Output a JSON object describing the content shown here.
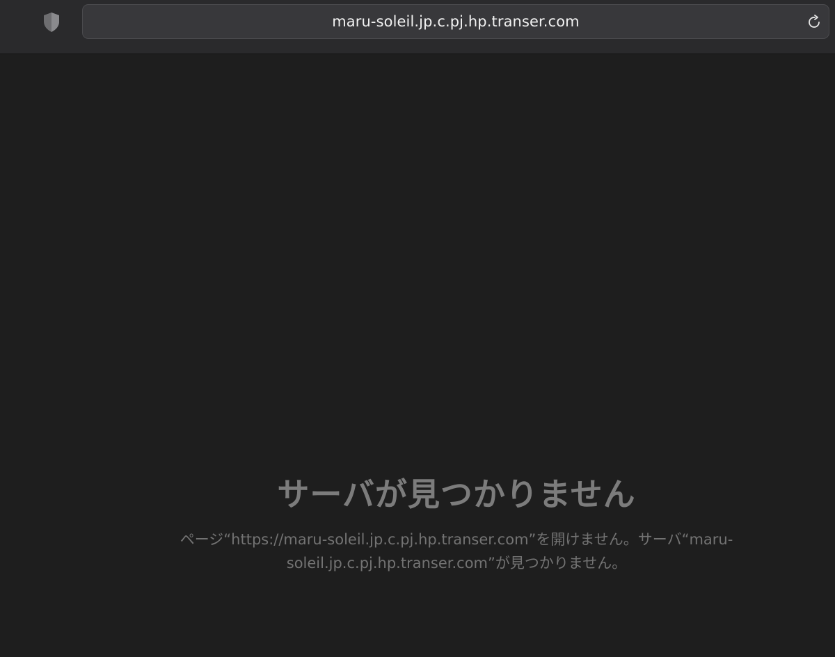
{
  "browser": {
    "address_bar": {
      "url": "maru-soleil.jp.c.pj.hp.transer.com"
    },
    "icons": {
      "privacy": "shield-icon",
      "reload": "reload-icon"
    }
  },
  "page": {
    "error_title": "サーバが見つかりません",
    "error_message": "ページ“https://maru-soleil.jp.c.pj.hp.transer.com”を開けません。サーバ“maru-soleil.jp.c.pj.hp.transer.com”が見つかりません。"
  },
  "colors": {
    "background": "#1e1e1e",
    "toolbar": "#2a2a2c",
    "address_bar": "#38383b",
    "text_primary": "#f2f2f2",
    "text_muted": "#7c7c7c"
  }
}
